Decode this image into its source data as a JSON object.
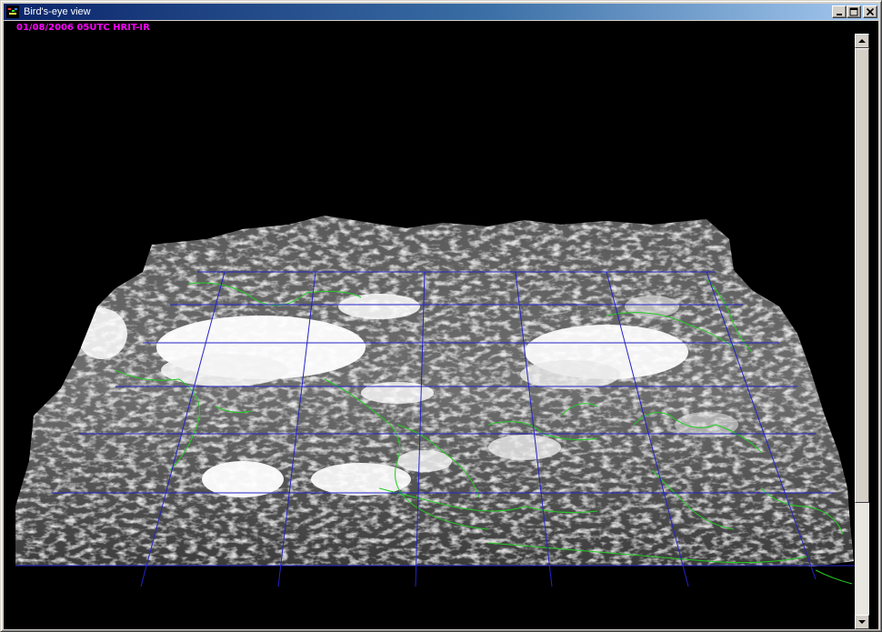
{
  "window": {
    "title": "Bird's-eye view",
    "title_bar_color_start": "#0a246a",
    "title_bar_color_end": "#a6caf0",
    "controls": [
      "minimize-icon",
      "maximize-icon",
      "close-icon"
    ]
  },
  "overlay": {
    "timestamp": "01/08/2006 05UTC HRIT-IR",
    "timestamp_color": "#ff00ff"
  },
  "render": {
    "description_colors": {
      "background": "#000000",
      "grid": "#2020c0",
      "coastline": "#22cc22",
      "cloud_tops": "#ffffff"
    }
  },
  "scrollbar": {
    "up_icon": "arrow-up-icon",
    "down_icon": "arrow-down-icon"
  }
}
